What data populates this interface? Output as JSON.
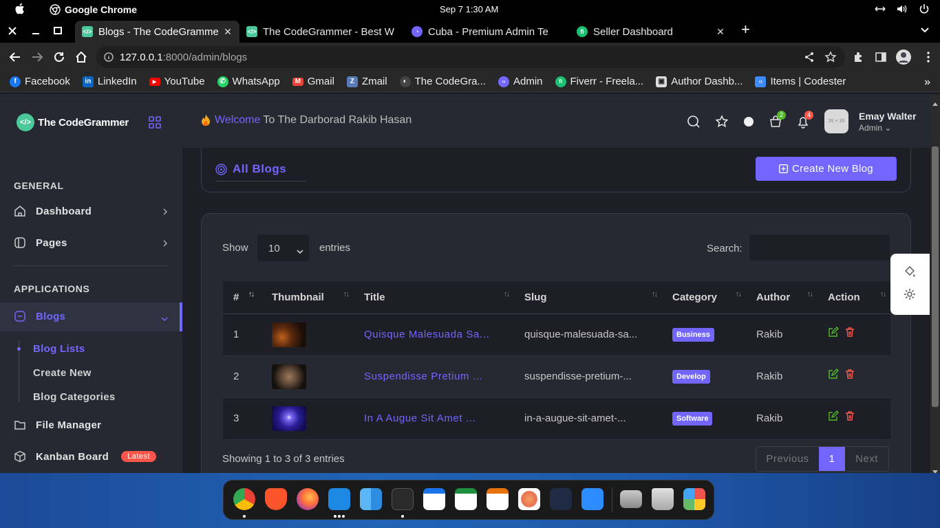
{
  "system_bar": {
    "app_name": "Google Chrome",
    "clock": "Sep 7   1:30 AM"
  },
  "browser": {
    "tabs": [
      {
        "title": "Blogs - The CodeGrammer",
        "active": true,
        "favicon_color": "#4cc99a"
      },
      {
        "title": "The CodeGrammer - Best W",
        "active": false,
        "favicon_color": "#4cc99a"
      },
      {
        "title": "Cuba - Premium Admin Te",
        "active": false,
        "favicon_color": "#7366ff"
      },
      {
        "title": "Seller Dashboard",
        "active": false,
        "favicon_color": "#1dbf73"
      }
    ],
    "url_host": "127.0.0.1",
    "url_rest": ":8000/admin/blogs",
    "bookmarks": [
      {
        "label": "Facebook",
        "color": "#1877f2",
        "glyph": "f"
      },
      {
        "label": "LinkedIn",
        "color": "#0a66c2",
        "glyph": "in"
      },
      {
        "label": "YouTube",
        "color": "#ff0000",
        "glyph": "▶"
      },
      {
        "label": "WhatsApp",
        "color": "#25d366",
        "glyph": "✆"
      },
      {
        "label": "Gmail",
        "color": "#ea4335",
        "glyph": "M"
      },
      {
        "label": "Zmail",
        "color": "#5a7ab8",
        "glyph": "Z"
      },
      {
        "label": "The CodeGra...",
        "color": "#444444",
        "glyph": "◐"
      },
      {
        "label": "Admin",
        "color": "#7366ff",
        "glyph": "‹›"
      },
      {
        "label": "Fiverr - Freela...",
        "color": "#1dbf73",
        "glyph": "fi"
      },
      {
        "label": "Author Dashb...",
        "color": "#222222",
        "glyph": "▣"
      },
      {
        "label": "Items | Codester",
        "color": "#3d8bfd",
        "glyph": "‹›"
      }
    ]
  },
  "sidebar": {
    "logo_text": "The CodeGrammer",
    "general_title": "GENERAL",
    "dashboard": "Dashboard",
    "pages": "Pages",
    "applications_title": "APPLICATIONS",
    "blogs": "Blogs",
    "blog_lists": "Blog Lists",
    "create_new": "Create New",
    "blog_categories": "Blog Categories",
    "file_manager": "File Manager",
    "kanban": "Kanban Board",
    "kanban_badge": "Latest"
  },
  "header": {
    "welcome_highlight": "Welcome",
    "welcome_rest": "To The Darborad Rakib Hasan",
    "cart_count": "2",
    "notif_count": "4",
    "avatar_placeholder": "35 × 35",
    "user_name": "Emay Walter",
    "user_role": "Admin"
  },
  "content": {
    "section_title": "All Blogs",
    "create_button": "Create New Blog",
    "show_label": "Show",
    "page_length": "10",
    "entries_label": "entries",
    "search_label": "Search:",
    "columns": [
      "#",
      "Thumbnail",
      "Title",
      "Slug",
      "Category",
      "Author",
      "Action"
    ],
    "rows": [
      {
        "num": "1",
        "title": "Quisque Malesuada Sa...",
        "slug": "quisque-malesuada-sa...",
        "category": "Business",
        "author": "Rakib",
        "thumb_colors": [
          "#2a1408",
          "#7a3a12"
        ]
      },
      {
        "num": "2",
        "title": "Suspendisse Pretium ...",
        "slug": "suspendisse-pretium-...",
        "category": "Develop",
        "author": "Rakib",
        "thumb_colors": [
          "#1a1410",
          "#8a6a50"
        ]
      },
      {
        "num": "3",
        "title": "In A Augue Sit Amet ...",
        "slug": "in-a-augue-sit-amet-...",
        "category": "Software",
        "author": "Rakib",
        "thumb_colors": [
          "#1c1470",
          "#6a60e0"
        ]
      }
    ],
    "showing_text": "Showing 1 to 3 of 3 entries",
    "pager": {
      "previous": "Previous",
      "current": "1",
      "next": "Next"
    }
  },
  "colors": {
    "accent": "#7366ff",
    "danger": "#fc564a",
    "success": "#51bb25"
  }
}
